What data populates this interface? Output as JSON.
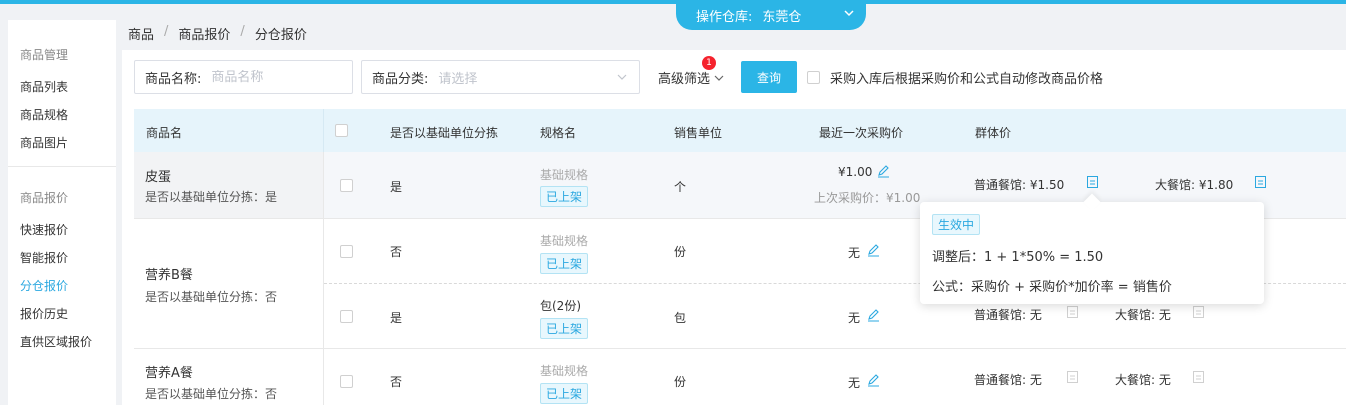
{
  "warehouse": {
    "label": "操作仓库:",
    "value": "东莞仓",
    "icon": "chevron-down-icon"
  },
  "sidebar": {
    "groups": [
      {
        "title": "商品管理",
        "items": [
          "商品列表",
          "商品规格",
          "商品图片"
        ]
      },
      {
        "title": "商品报价",
        "items": [
          "快速报价",
          "智能报价",
          "分仓报价",
          "报价历史",
          "直供区域报价"
        ]
      }
    ],
    "active_item": "分仓报价"
  },
  "breadcrumb": [
    "商品",
    "商品报价",
    "分仓报价"
  ],
  "filters": {
    "name_label": "商品名称:",
    "name_placeholder": "商品名称",
    "category_label": "商品分类:",
    "category_placeholder": "请选择",
    "advanced_label": "高级筛选",
    "advanced_badge": "1",
    "query_button": "查询",
    "auto_update_label": "采购入库后根据采购价和公式自动修改商品价格"
  },
  "table": {
    "headers": {
      "name": "商品名",
      "split": "是否以基础单位分拣",
      "spec": "规格名",
      "unit": "销售单位",
      "last_price": "最近一次采购价",
      "group_price": "群体价"
    },
    "products": [
      {
        "name": "皮蛋",
        "sub": "是否以基础单位分拣：是",
        "rows": [
          {
            "split": "是",
            "spec": "基础规格",
            "tag": "已上架",
            "unit": "个",
            "price": "¥1.00",
            "last": "上次采购价：¥1.00",
            "normal": "普通餐馆: ¥1.50",
            "large": "大餐馆: ¥1.80"
          }
        ]
      },
      {
        "name": "营养B餐",
        "sub": "是否以基础单位分拣：否",
        "rows": [
          {
            "split": "否",
            "spec": "基础规格",
            "tag": "已上架",
            "unit": "份",
            "price": "无"
          },
          {
            "split": "是",
            "spec": "包(2份)",
            "tag": "已上架",
            "unit": "包",
            "price": "无",
            "normal": "普通餐馆: 无",
            "large": "大餐馆: 无"
          }
        ]
      },
      {
        "name": "营养A餐",
        "sub": "是否以基础单位分拣：否",
        "rows": [
          {
            "split": "否",
            "spec": "基础规格",
            "tag": "已上架",
            "unit": "份",
            "price": "无",
            "normal": "普通餐馆: 无",
            "large": "大餐馆: 无"
          }
        ]
      }
    ]
  },
  "popover": {
    "status": "生效中",
    "adjusted": "调整后：1 + 1*50% = 1.50",
    "formula": "公式：采购价 + 采购价*加价率 = 销售价"
  },
  "colors": {
    "accent": "#2bb5e6",
    "badge": "#f5222d",
    "link": "#2ba8e0"
  }
}
